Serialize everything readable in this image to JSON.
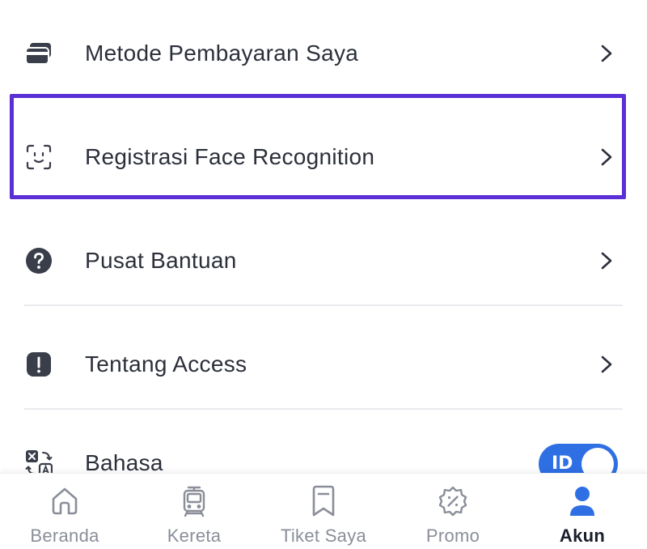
{
  "menu": {
    "payment": {
      "label": "Metode Pembayaran Saya",
      "icon": "card-icon"
    },
    "face": {
      "label": "Registrasi Face Recognition",
      "icon": "face-scan-icon"
    },
    "help": {
      "label": "Pusat Bantuan",
      "icon": "question-icon"
    },
    "about": {
      "label": "Tentang Access",
      "icon": "info-exclamation-icon"
    },
    "language": {
      "label": "Bahasa",
      "icon": "translate-icon",
      "toggle_value": "ID"
    }
  },
  "bottom_nav": {
    "items": [
      {
        "label": "Beranda",
        "icon": "home-icon",
        "active": false
      },
      {
        "label": "Kereta",
        "icon": "train-icon",
        "active": false
      },
      {
        "label": "Tiket Saya",
        "icon": "ticket-icon",
        "active": false
      },
      {
        "label": "Promo",
        "icon": "promo-badge-icon",
        "active": false
      },
      {
        "label": "Akun",
        "icon": "user-icon",
        "active": true
      }
    ]
  },
  "colors": {
    "highlight": "#5a2fd6",
    "toggle": "#2f6fe4",
    "text": "#2b2f3a",
    "icon": "#3a3e4a",
    "inactive_nav": "#8a8e99",
    "active_nav_icon": "#2f6fe4"
  }
}
